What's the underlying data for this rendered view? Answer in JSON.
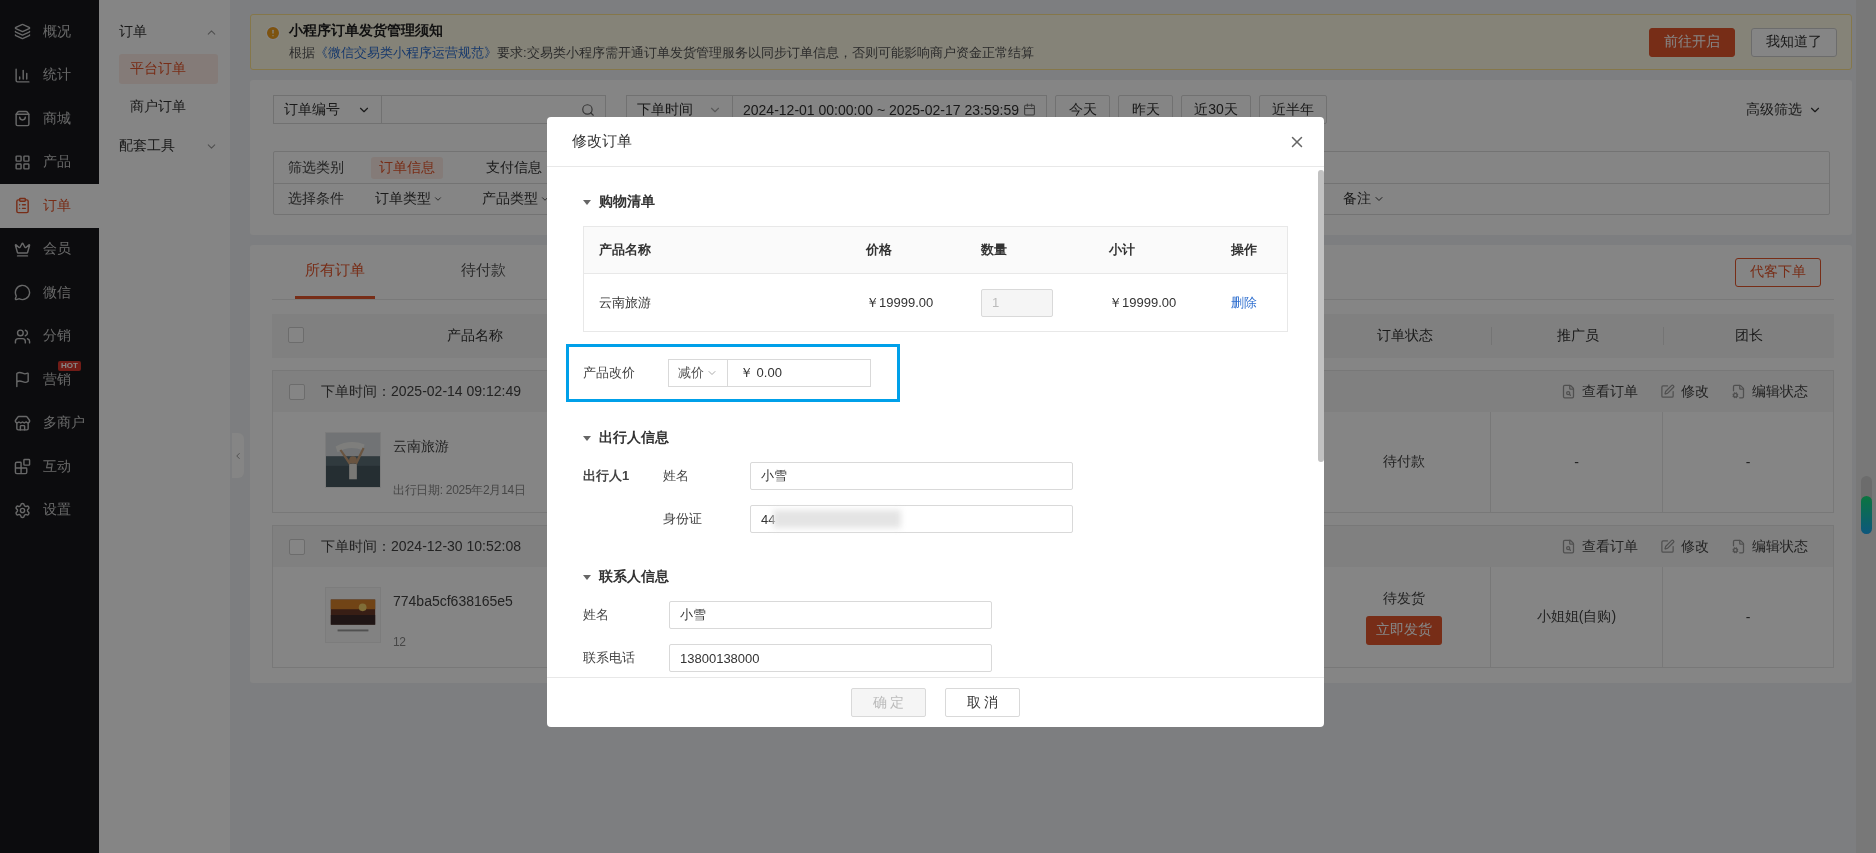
{
  "sidebar": {
    "items": [
      {
        "label": "概况",
        "selected": false
      },
      {
        "label": "统计",
        "selected": false
      },
      {
        "label": "商城",
        "selected": false
      },
      {
        "label": "产品",
        "selected": false
      },
      {
        "label": "订单",
        "selected": true
      },
      {
        "label": "会员",
        "selected": false
      },
      {
        "label": "微信",
        "selected": false
      },
      {
        "label": "分销",
        "selected": false
      },
      {
        "label": "营销",
        "selected": false,
        "badge": "HOT"
      },
      {
        "label": "多商户",
        "selected": false
      },
      {
        "label": "互动",
        "selected": false
      },
      {
        "label": "设置",
        "selected": false
      }
    ]
  },
  "submenu": {
    "groups": [
      {
        "label": "订单",
        "expanded": true,
        "children": [
          {
            "label": "平台订单",
            "selected": true
          },
          {
            "label": "商户订单",
            "selected": false
          }
        ]
      },
      {
        "label": "配套工具",
        "expanded": false
      }
    ]
  },
  "notice": {
    "title": "小程序订单发货管理须知",
    "text_before": "根据",
    "link": "《微信交易类小程序运营规范》",
    "text_after": "要求:交易类小程序需开通订单发货管理服务以同步订单信息，否则可能影响商户资金正常结算",
    "buttons": [
      {
        "label": "前往开启",
        "kind": "primary"
      },
      {
        "label": "我知道了",
        "kind": "default"
      }
    ]
  },
  "search": {
    "field_select": "订单编号",
    "time_select": "下单时间",
    "date_range": "2024-12-01 00:00:00 ~ 2025-02-17 23:59:59",
    "quick_ranges": [
      "今天",
      "昨天",
      "近30天",
      "近半年"
    ],
    "advanced": "高级筛选"
  },
  "filters": [
    {
      "label": "筛选类别",
      "kind": "tag",
      "options": [
        {
          "label": "订单信息",
          "selected": true
        },
        {
          "label": "支付信息",
          "selected": false
        }
      ]
    },
    {
      "label": "选择条件",
      "kind": "dropdown",
      "options": [
        {
          "label": "订单类型"
        },
        {
          "label": "产品类型"
        }
      ],
      "trailing": [
        {
          "label": "备注"
        }
      ]
    }
  ],
  "orders": {
    "tabs": [
      {
        "label": "所有订单",
        "selected": true
      },
      {
        "label": "待付款",
        "selected": false
      }
    ],
    "create_button": "代客下单",
    "columns": [
      "产品名称",
      "订单状态",
      "推广员",
      "团长"
    ],
    "header_checked": false,
    "rows": [
      {
        "checked": false,
        "time": "下单时间：2025-02-14 09:12:49",
        "actions": [
          "查看订单",
          "修改",
          "编辑状态"
        ],
        "product": {
          "name": "云南旅游",
          "detail": "出行日期: 2025年2月14日"
        },
        "status": "待付款",
        "promoter": "-",
        "leader": "-"
      },
      {
        "checked": false,
        "time": "下单时间：2024-12-30 10:52:08",
        "actions": [
          "查看订单",
          "修改",
          "编辑状态"
        ],
        "product": {
          "name": "774ba5cf638165e5",
          "detail": "12"
        },
        "status": "待发货",
        "status_action": "立即发货",
        "promoter": "小姐姐(自购)",
        "leader": "-"
      }
    ]
  },
  "dialog": {
    "title": "修改订单",
    "sections": [
      {
        "kind": "cart",
        "title": "购物清单",
        "expanded": true,
        "columns": [
          "产品名称",
          "价格",
          "数量",
          "小计",
          "操作"
        ],
        "rows": [
          {
            "name": "云南旅游",
            "price": "￥19999.00",
            "quantity": "1",
            "quantity_disabled": true,
            "subtotal": "￥19999.00",
            "action": "删除"
          }
        ],
        "price_change": {
          "label": "产品改价",
          "mode": "减价",
          "value": "￥ 0.00",
          "highlighted": true
        }
      },
      {
        "kind": "travelers",
        "title": "出行人信息",
        "expanded": true,
        "travelers": [
          {
            "label": "出行人1",
            "fields": [
              {
                "label": "姓名",
                "value": "小雪",
                "redacted": false
              },
              {
                "label": "身份证",
                "value": "44",
                "redacted": true
              }
            ]
          }
        ]
      },
      {
        "kind": "contact",
        "title": "联系人信息",
        "expanded": true,
        "fields": [
          {
            "label": "姓名",
            "value": "小雪"
          },
          {
            "label": "联系电话",
            "value": "13800138000"
          }
        ]
      }
    ],
    "buttons": [
      {
        "label": "确 定",
        "disabled": true
      },
      {
        "label": "取 消",
        "disabled": false
      }
    ]
  }
}
